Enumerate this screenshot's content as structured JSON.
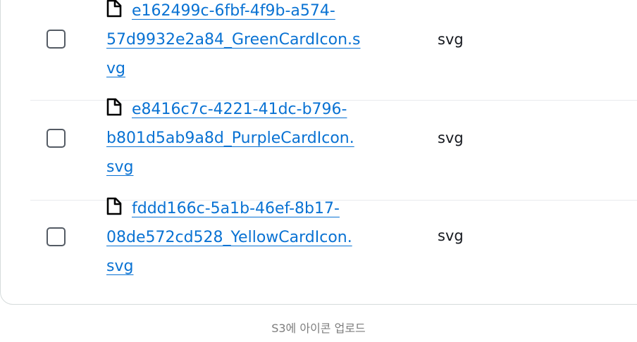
{
  "files": [
    {
      "name_line1": "e162499c-6fbf-4f9b-a574-",
      "name_line2": "57d9932e2a84_GreenCardIcon.s",
      "name_line3": "vg",
      "type": "svg"
    },
    {
      "name_line1": "e8416c7c-4221-41dc-b796-",
      "name_line2": "b801d5ab9a8d_PurpleCardIcon.",
      "name_line3": "svg",
      "type": "svg"
    },
    {
      "name_line1": "fddd166c-5a1b-46ef-8b17-",
      "name_line2": "08de572cd528_YellowCardIcon.",
      "name_line3": "svg",
      "type": "svg"
    }
  ],
  "caption": "S3에 아이콘 업로드",
  "colors": {
    "link": "#0972d3",
    "text": "#16191f",
    "checkbox_border": "#545b64",
    "caption": "#7d7d7d"
  },
  "icons": {
    "file": "file-icon"
  }
}
